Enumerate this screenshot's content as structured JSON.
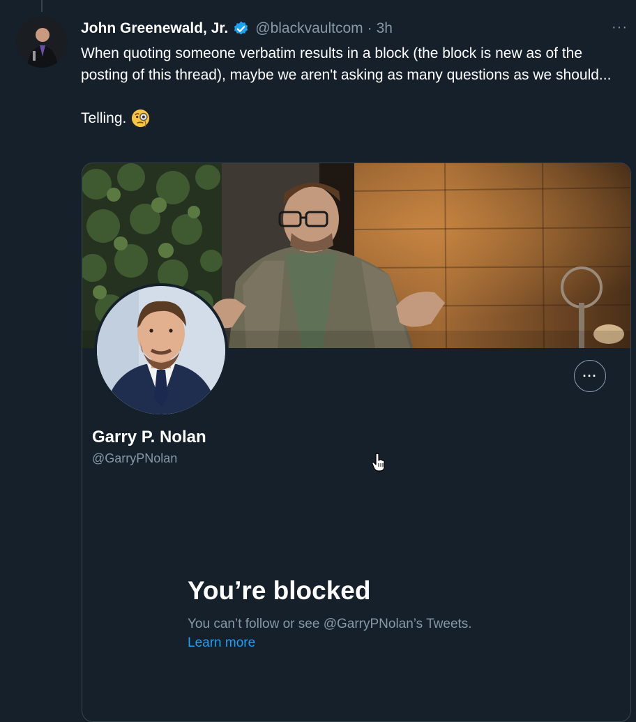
{
  "tweet": {
    "author_name": "John Greenewald, Jr.",
    "handle": "@blackvaultcom",
    "separator": "·",
    "time": "3h",
    "more": "···",
    "text_p1": "When quoting someone verbatim results in a block (the block is new as of the posting of this thread), maybe we aren't asking as many questions as we should...",
    "text_p2": "Telling.",
    "emoji_icon": "face-with-monocle"
  },
  "profile_card": {
    "name": "Garry P. Nolan",
    "handle": "@GarryPNolan",
    "more": "···",
    "blocked_title": "You’re blocked",
    "blocked_desc": "You can’t follow or see @GarryPNolan’s Tweets.",
    "learn_more": "Learn more"
  },
  "colors": {
    "background": "#15202b",
    "secondary_text": "#8899a6",
    "link": "#1da1f2",
    "border": "#38444d",
    "verified": "#1da1f2"
  }
}
